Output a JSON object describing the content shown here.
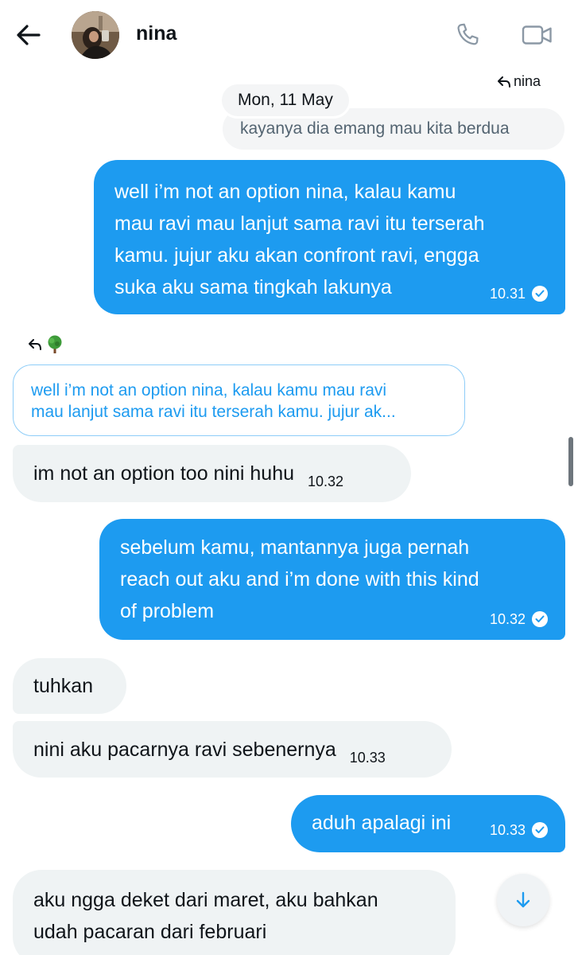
{
  "header": {
    "contact_name": "nina"
  },
  "icons": {
    "back": "arrow-left-icon",
    "call": "phone-icon",
    "video": "video-camera-icon",
    "reply": "reply-arrow-icon",
    "tree_emoji": "deciduous-tree-emoji",
    "read": "check-circle-icon",
    "scroll_down": "arrow-down-icon"
  },
  "colors": {
    "outgoing_bubble": "#1d9bf0",
    "incoming_bubble": "#eff3f4",
    "quote_border": "#8ecdf8"
  },
  "conversation": {
    "reply_label_1": "nina",
    "date_chip": "Mon, 11 May",
    "quoted_previous": "kayanya dia emang mau kita berdua",
    "reply_label_2": "🌳",
    "quote_preview_line1": "well i’m not an option nina, kalau kamu mau ravi",
    "quote_preview_line2": "mau lanjut sama ravi itu terserah kamu. jujur ak...",
    "messages": [
      {
        "direction": "out",
        "lines": [
          "well i’m not an option nina, kalau kamu",
          "mau ravi mau lanjut sama ravi itu terserah",
          "kamu. jujur aku akan confront ravi, engga",
          "suka aku sama tingkah lakunya"
        ],
        "time": "10.31",
        "read": true
      },
      {
        "direction": "in",
        "text": "im not an option too nini huhu",
        "time": "10.32"
      },
      {
        "direction": "out",
        "lines": [
          "sebelum kamu, mantannya juga pernah",
          "reach out aku and i’m done with this kind",
          "of problem"
        ],
        "time": "10.32",
        "read": true
      },
      {
        "direction": "in",
        "text": "tuhkan"
      },
      {
        "direction": "in",
        "text": "nini aku pacarnya ravi sebenernya",
        "time": "10.33"
      },
      {
        "direction": "out",
        "text": "aduh apalagi ini",
        "time": "10.33",
        "read": true
      },
      {
        "direction": "in",
        "lines": [
          "aku ngga deket dari maret, aku bahkan",
          "udah pacaran dari februari"
        ]
      }
    ]
  }
}
